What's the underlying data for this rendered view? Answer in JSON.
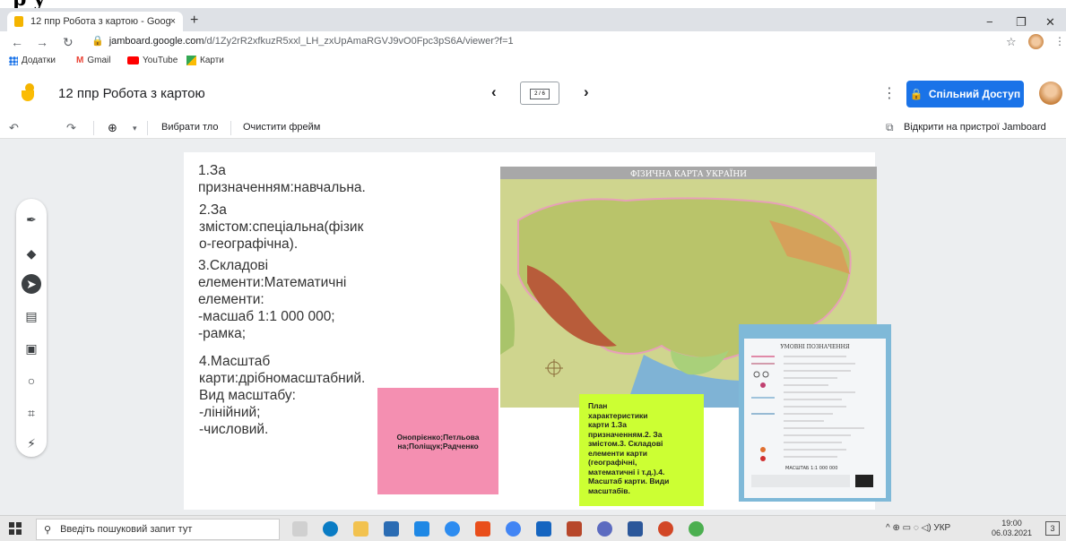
{
  "artifact_top": "р у",
  "browser": {
    "tab_title": "12 ппр Робота з картою - Goog",
    "tab_close": "×",
    "new_tab": "+",
    "url_main": "jamboard.google.com",
    "url_path": "/d/1Zy2rR2xfkuzR5xxl_LH_zxUpAmaRGVJ9vO0Fpc3pS6A/viewer?f=1",
    "window_controls": [
      "−",
      "❐",
      "✕"
    ]
  },
  "bookmarks": [
    {
      "label": "Додатки",
      "icon": "apps-icon"
    },
    {
      "label": "Gmail",
      "icon": "gmail-icon"
    },
    {
      "label": "YouTube",
      "icon": "youtube-icon"
    },
    {
      "label": "Карти",
      "icon": "maps-icon"
    }
  ],
  "jamboard": {
    "title": "12 ппр Робота з картою",
    "frame_indicator": "2 / 6",
    "share_label": "Спільний Доступ",
    "toolbar": {
      "set_background": "Вибрати тло",
      "clear_frame": "Очистити фрейм",
      "open_on_device": "Відкрити на пристрої Jamboard"
    }
  },
  "board": {
    "text_lines": [
      "1.За\nпризначенням:навчальна.",
      "2.За\nзмістом:спеціальна(фізик\nо-географічна).",
      "3.Складові\nелементи:Математичні\nелементи:\n-масшаб 1:1 000 000;\n-рамка;",
      "4.Масштаб\nкарти:дрібномасштабний.\nВид масштабу:\n-лінійний;\n-числовий."
    ],
    "map_title": "ФІЗИЧНА КАРТА УКРАЇНИ",
    "legend_title": "УМОВНІ ПОЗНАЧЕННЯ",
    "legend_scale": "МАСШТАБ 1:1 000 000",
    "sticky_pink": "Онопрієнко;Петльова\nна;Поліщук;Радченко",
    "sticky_green": "План\nхарактеристики\nкарти 1.За\nпризначенням.2. За\nзмістом.3. Складові\nелементи карти\n(географічні,\nматематичні і т.д.).4.\nМасштаб карти. Види\nмасштабів."
  },
  "taskbar": {
    "search_placeholder": "Введіть пошуковий запит тут",
    "lang": "УКР",
    "time": "19:00",
    "date": "06.03.2021",
    "notif_count": "3"
  },
  "colors": {
    "share_blue": "#1a73e8",
    "sticky_pink": "#f48fb1",
    "sticky_green": "#ccff33"
  }
}
